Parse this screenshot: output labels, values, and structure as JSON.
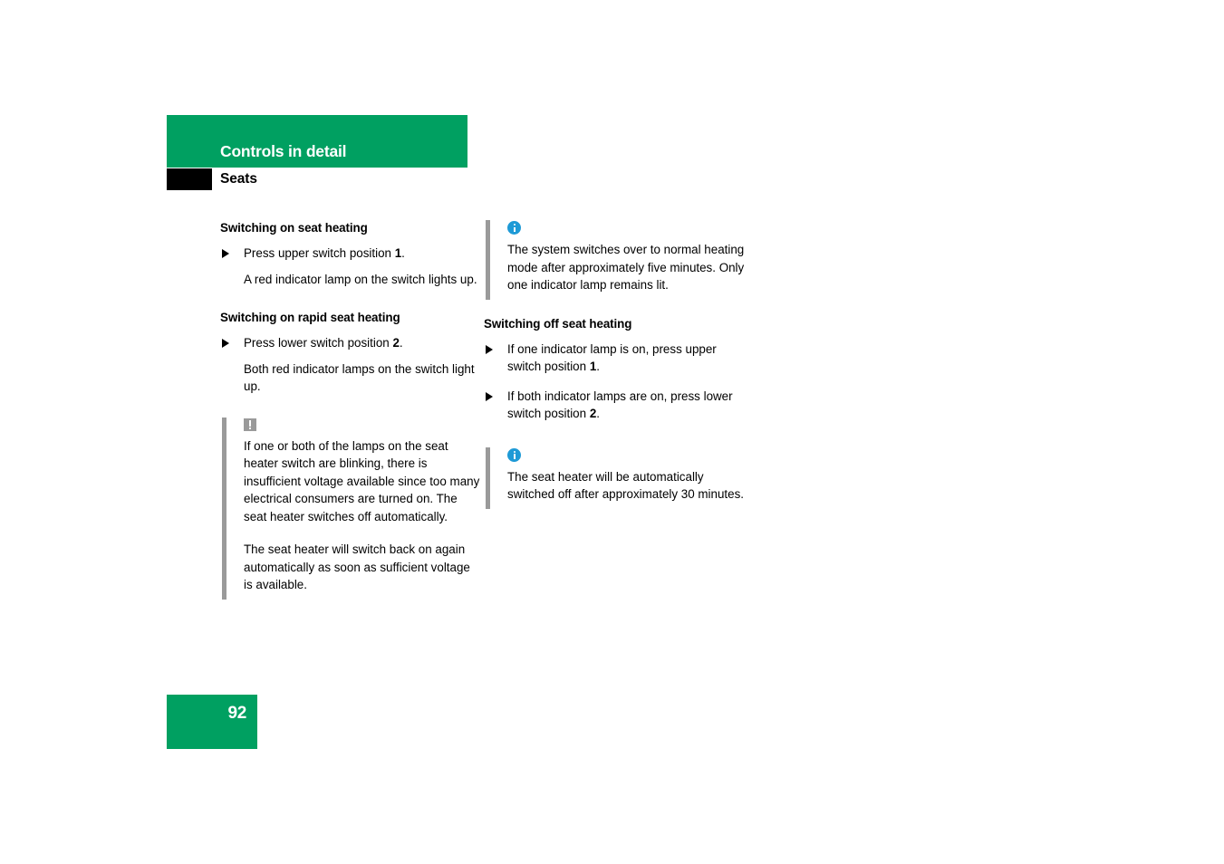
{
  "document": {
    "header_title": "Controls in detail",
    "section_title": "Seats",
    "page_number": "92"
  },
  "theme": {
    "brand_green": "#00a061",
    "rule_grey": "#9a9a9a",
    "info_blue": "#1e9ad6",
    "tab_black": "#000000"
  },
  "left_column": {
    "section_1": {
      "heading": "Switching on seat heating",
      "bullet_1_pre": "Press upper switch position ",
      "bullet_1_bold": "1",
      "bullet_1_post": ".",
      "body_1": "A red indicator lamp on the switch lights up."
    },
    "section_2": {
      "heading": "Switching on rapid seat heating",
      "bullet_1_pre": "Press lower switch position ",
      "bullet_1_bold": "2",
      "bullet_1_post": ".",
      "body_1": "Both red indicator lamps on the switch light up."
    },
    "warning_note": {
      "icon": "warning-exclamation-icon",
      "paragraph_1": "If one or both of the lamps on the seat heater switch are blinking, there is insufficient voltage available since too many electrical consumers are turned on. The seat heater switches off automatically.",
      "paragraph_2": "The seat heater will switch back on again automatically as soon as sufficient voltage is available."
    }
  },
  "right_column": {
    "info_note_1": {
      "icon": "info-circle-icon",
      "paragraph_1": "The system switches over to normal heating mode after approximately five minutes. Only one indicator lamp remains lit."
    },
    "section_3": {
      "heading": "Switching off seat heating",
      "bullet_1_pre": "If one indicator lamp is on, press upper switch position ",
      "bullet_1_bold": "1",
      "bullet_1_post": ".",
      "bullet_2_pre": "If both indicator lamps are on, press lower switch position ",
      "bullet_2_bold": "2",
      "bullet_2_post": "."
    },
    "info_note_2": {
      "icon": "info-circle-icon",
      "paragraph_1": "The seat heater will be automatically switched off after approximately 30 minutes."
    }
  }
}
